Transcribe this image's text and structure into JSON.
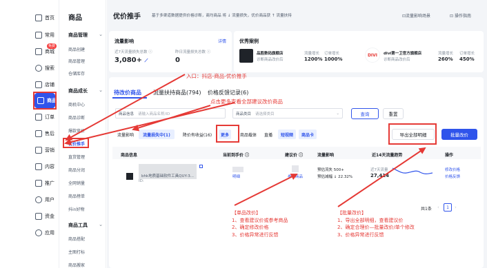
{
  "rail": {
    "items": [
      {
        "label": "首页",
        "icon": "home-icon"
      },
      {
        "label": "常用",
        "icon": "bookmark-icon"
      },
      {
        "label": "商城",
        "icon": "shop-icon",
        "badge": "免费"
      },
      {
        "label": "搜索",
        "icon": "search-icon"
      },
      {
        "label": "店铺",
        "icon": "store-icon"
      },
      {
        "label": "商品",
        "icon": "goods-icon"
      },
      {
        "label": "订单",
        "icon": "order-icon"
      },
      {
        "label": "售后",
        "icon": "aftersale-icon"
      },
      {
        "label": "营销",
        "icon": "megaphone-icon"
      },
      {
        "label": "内容",
        "icon": "content-icon"
      },
      {
        "label": "推广",
        "icon": "promotion-icon"
      },
      {
        "label": "用户",
        "icon": "user-icon"
      },
      {
        "label": "资金",
        "icon": "wallet-icon"
      },
      {
        "label": "应用",
        "icon": "app-icon"
      }
    ]
  },
  "sub": {
    "title": "商品",
    "group1": "商品管理",
    "links1": [
      "商品创建",
      "商品管理",
      "仓储库存"
    ],
    "group2": "商品成长",
    "links2": [
      "商机中心",
      "商品诊断",
      "爆款竞价",
      "优价推手",
      "直货管理",
      "商品分润",
      "全网销量",
      "商品榜单",
      "抖in好物"
    ],
    "group3": "商品工具",
    "links3": [
      "商品搭配",
      "主图打标",
      "商品搬家"
    ]
  },
  "header": {
    "title": "优价推手",
    "desc": "基于多渠道数据提供价格诊断，商均商品 将 ↓ 流量损失，优价商品获 ↑ 流量扶持",
    "link1": "流量影响场景",
    "link2": "操作指南"
  },
  "impact": {
    "title": "流量影响",
    "detail": "详情",
    "m1_label": "近7天流量损失总数 ⓘ",
    "m1_value": "3,080+",
    "m2_label": "昨日流量损失总数 ⓘ",
    "m2_value": "0"
  },
  "cases": {
    "title": "优秀案例",
    "c1_name": "品胜数码旗舰店",
    "c1_sub": "诊断商品改价后",
    "c1_h1": "流量增长",
    "c1_h2": "订单增长",
    "c1_v1": "1200%",
    "c1_v2": "1000%",
    "c2_logo": "DIVI",
    "c2_name": "divi第一卫官方旗舰店",
    "c2_sub": "诊断商品改价后",
    "c2_h1": "流量增长",
    "c2_h2": "订单增长",
    "c2_v1": "260%",
    "c2_v2": "450%"
  },
  "annotations": {
    "entry": "入口：抖店-商品-优价推手",
    "more": "点击更多查看全部建议改价商品",
    "single_title": "【单品改价】",
    "single_lines": [
      "1、查看建议价或参考商品",
      "2、确定修改价格",
      "3、价格异常进行反馈"
    ],
    "batch_title": "【批量改价】",
    "batch_lines": [
      "1、导出全部明细，查看建议价",
      "2、确定合理价—批量改价/单个修改",
      "3、价格异常进行反馈"
    ]
  },
  "tabs": [
    "待改价商品",
    "流量扶持商品(794)",
    "价格反馈记录(6)"
  ],
  "filters": {
    "name_label": "商品信息",
    "name_placeholder": "请输入商品名称/ID",
    "category_label": "商品类目",
    "category_placeholder": "请选择类目",
    "query": "查询",
    "reset": "重置"
  },
  "chips": {
    "label": "流量影响",
    "c1": "流量损失中(1)",
    "c2": "降价有收益(16)",
    "more": "更多",
    "label2": "商品载体",
    "c3": "直播",
    "c4": "短视频",
    "c5": "商品卡"
  },
  "actions": {
    "export": "导出全部明细",
    "batch": "批量改价"
  },
  "table": {
    "headers": [
      "商品信息",
      "当前到手价 ⓘ",
      "建议价 ⓘ",
      "流量影响",
      "近14天流量趋势",
      "操作"
    ],
    "row": {
      "title": "bhk地质基础软件工具QUY-3...",
      "id": "ID:",
      "current_price_link": "明细",
      "ref_link": "参考商品",
      "loss_line1": "预估流失 500+",
      "loss_line2": "预估减幅 ↓ 22.32%",
      "trend_label": "近7天流量",
      "trend_value": "27,414",
      "op1": "修改价格",
      "op2": "价格反馈"
    }
  },
  "pager": {
    "total": "共1条",
    "page": "1"
  },
  "colors": {
    "accent": "#2f54eb",
    "annotation": "#e53935"
  }
}
